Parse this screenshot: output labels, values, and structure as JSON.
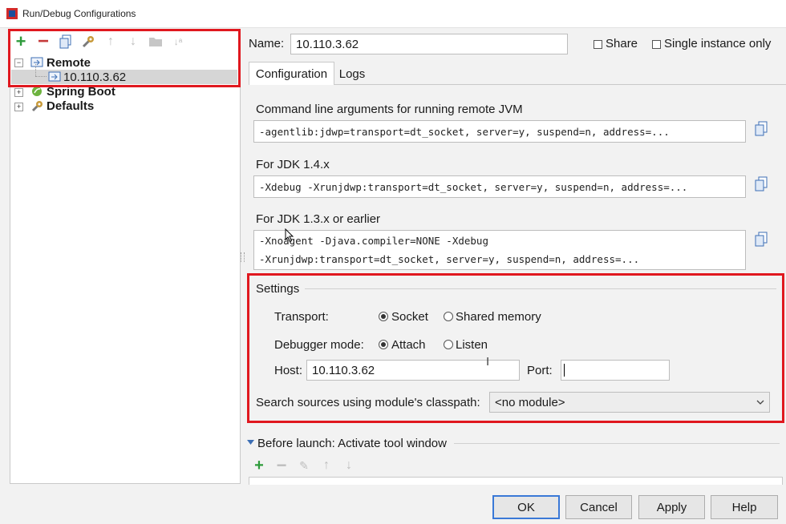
{
  "window": {
    "title": "Run/Debug Configurations"
  },
  "tree": {
    "toolbar_icons": [
      "add-icon",
      "remove-icon",
      "copy-icon",
      "wrench-icon",
      "arrow-up-icon",
      "arrow-down-icon",
      "folder-icon",
      "sort-icon"
    ],
    "remote_label": "Remote",
    "remote_child": "10.110.3.62",
    "spring_boot_label": "Spring Boot",
    "defaults_label": "Defaults"
  },
  "header": {
    "name_label": "Name:",
    "name_value": "10.110.3.62",
    "share_label": "Share",
    "single_instance_label": "Single instance only"
  },
  "tabs": [
    "Configuration",
    "Logs"
  ],
  "config": {
    "cmd_title": "Command line arguments for running remote JVM",
    "cmd_value": "-agentlib:jdwp=transport=dt_socket, server=y, suspend=n, address=...",
    "jdk14_title": "For JDK 1.4.x",
    "jdk14_value": "-Xdebug -Xrunjdwp:transport=dt_socket, server=y, suspend=n, address=...",
    "jdk13_title": "For JDK 1.3.x or earlier",
    "jdk13_line1": "-Xnoagent -Djava.compiler=NONE -Xdebug",
    "jdk13_line2": "-Xrunjdwp:transport=dt_socket, server=y, suspend=n, address=..."
  },
  "settings": {
    "title": "Settings",
    "transport_label": "Transport:",
    "transport_socket": "Socket",
    "transport_shared": "Shared memory",
    "debugger_label": "Debugger mode:",
    "debugger_attach": "Attach",
    "debugger_listen": "Listen",
    "host_label": "Host:",
    "host_value": "10.110.3.62",
    "port_label": "Port:",
    "port_value": "",
    "search_label": "Search sources using module's classpath:",
    "module_value": "<no module>"
  },
  "before_launch": {
    "title": "Before launch: Activate tool window"
  },
  "buttons": {
    "ok": "OK",
    "cancel": "Cancel",
    "apply": "Apply",
    "help": "Help"
  },
  "colors": {
    "highlight_red": "#e0181f",
    "add_green": "#2e9b3b",
    "remove_red": "#c53b3b",
    "accent_blue": "#3a79d7"
  }
}
